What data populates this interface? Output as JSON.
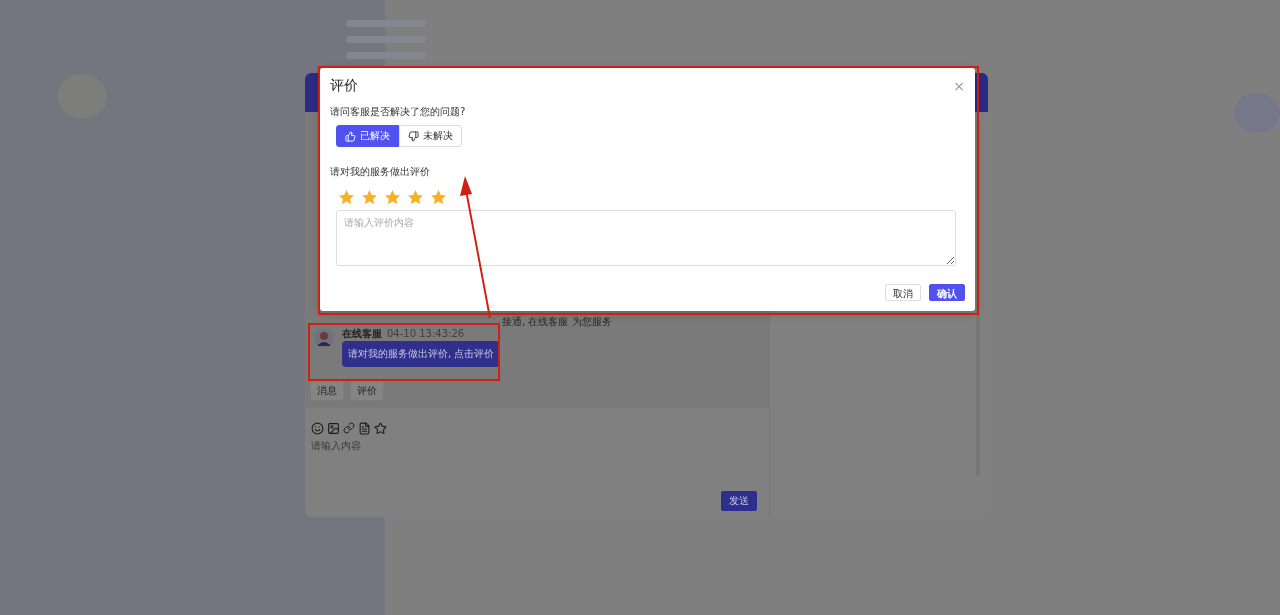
{
  "chat": {
    "system_notice": "接通, 在线客服 为您服务",
    "messages": [
      {
        "sender": "在线客服",
        "time": "04-10 13:43:26",
        "text": "请对我的服务做出评价, 点击评价"
      }
    ],
    "quick_replies": [
      "消息",
      "评价"
    ],
    "input": {
      "placeholder": "请输入内容"
    },
    "send_button": "发送"
  },
  "dialog": {
    "title": "评价",
    "close": "×",
    "question": "请问客服是否解决了您的问题?",
    "options": [
      {
        "label": "已解决",
        "kind": "up",
        "selected": true
      },
      {
        "label": "未解决",
        "kind": "down",
        "selected": false
      }
    ],
    "rating_label": "请对我的服务做出评价",
    "stars": 5,
    "comment": {
      "placeholder": "请输入评价内容"
    },
    "buttons": [
      {
        "label": "取消",
        "kind": "default"
      },
      {
        "label": "确认",
        "kind": "primary"
      }
    ]
  }
}
